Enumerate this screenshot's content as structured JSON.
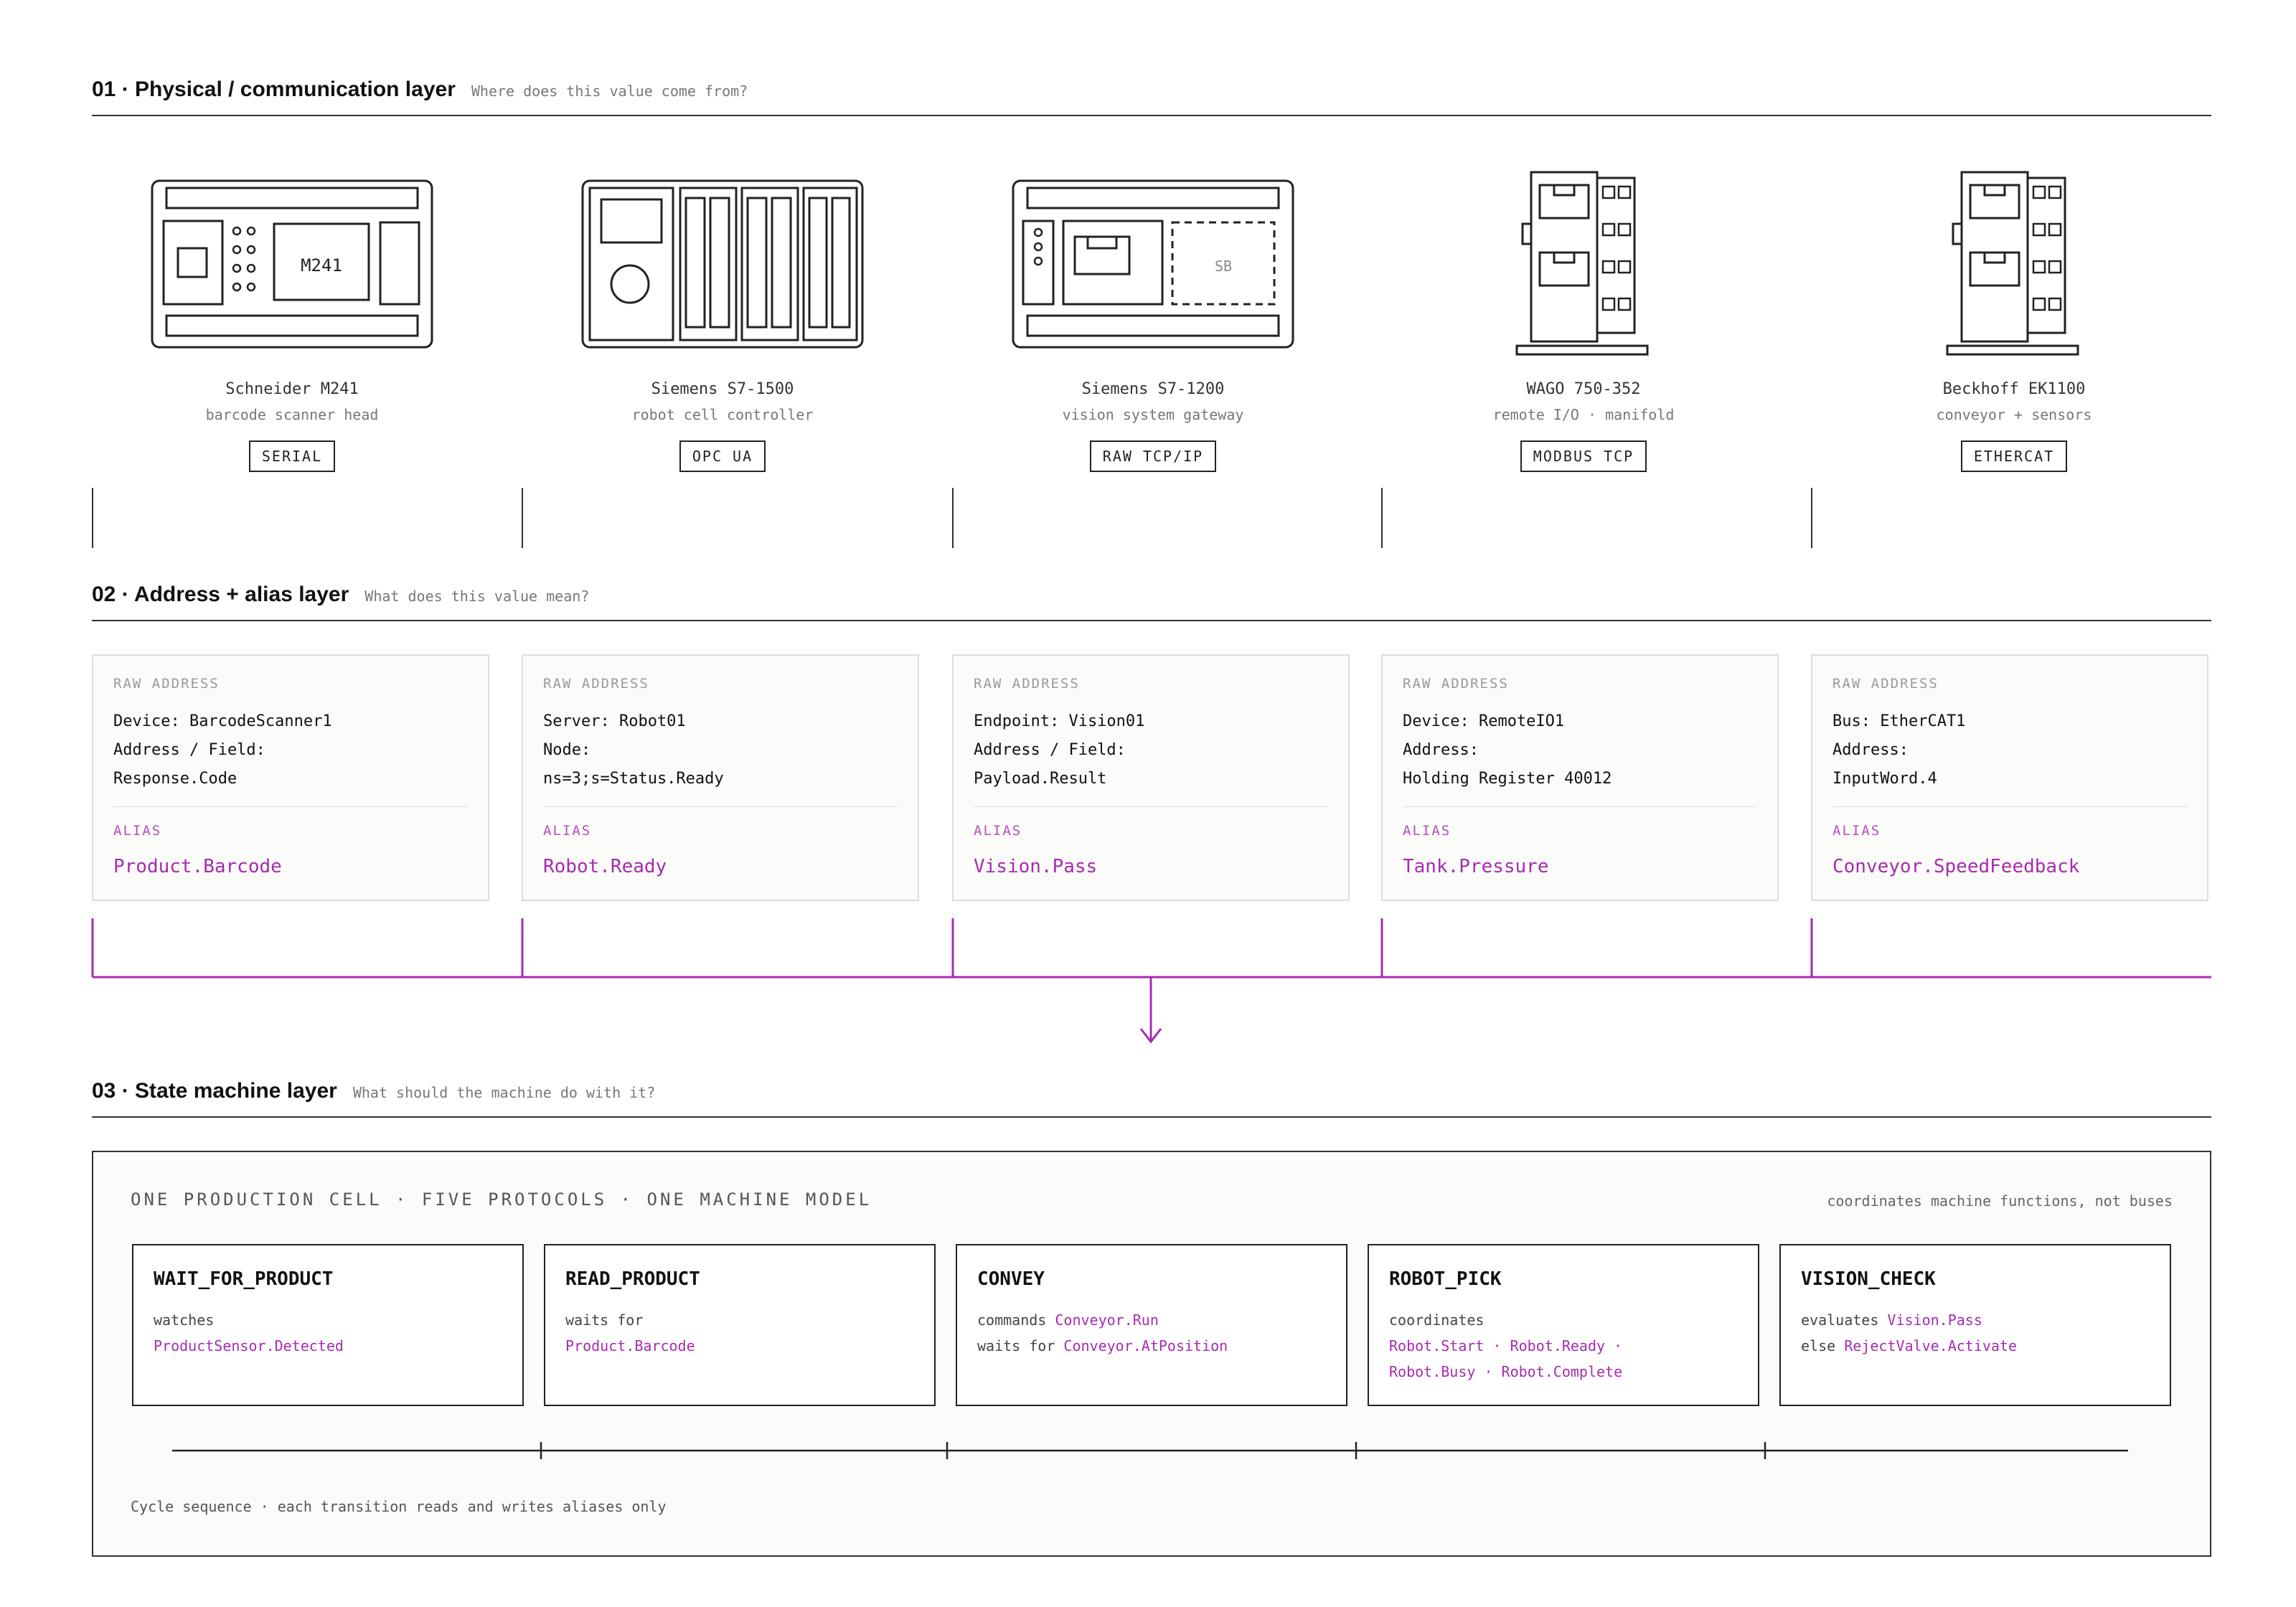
{
  "sections": {
    "s1": {
      "title": "01 · Physical / communication layer",
      "sub": "Where does this value come from?"
    },
    "s2": {
      "title": "02 · Address + alias layer",
      "sub": "What does this value mean?"
    },
    "s3": {
      "title": "03 · State machine layer",
      "sub": "What should the machine do with it?"
    }
  },
  "devices": [
    {
      "name": "Schneider M241",
      "desc": "barcode scanner head",
      "protocol": "SERIAL",
      "module_label": "M241",
      "icon": "plc-compact-icon"
    },
    {
      "name": "Siemens S7-1500",
      "desc": "robot cell controller",
      "protocol": "OPC UA",
      "icon": "plc-modular-icon"
    },
    {
      "name": "Siemens S7-1200",
      "desc": "vision system gateway",
      "protocol": "RAW TCP/IP",
      "module_label": "SB",
      "icon": "plc-signal-board-icon"
    },
    {
      "name": "WAGO 750-352",
      "desc": "remote I/O · manifold",
      "protocol": "MODBUS TCP",
      "icon": "remote-io-icon"
    },
    {
      "name": "Beckhoff EK1100",
      "desc": "conveyor + sensors",
      "protocol": "ETHERCAT",
      "icon": "bus-coupler-icon"
    }
  ],
  "cards": [
    {
      "raw_label": "RAW ADDRESS",
      "raw": "Device: BarcodeScanner1\nAddress / Field:\nResponse.Code",
      "alias_label": "ALIAS",
      "alias": "Product.Barcode"
    },
    {
      "raw_label": "RAW ADDRESS",
      "raw": "Server: Robot01\nNode:\nns=3;s=Status.Ready",
      "alias_label": "ALIAS",
      "alias": "Robot.Ready"
    },
    {
      "raw_label": "RAW ADDRESS",
      "raw": "Endpoint: Vision01\nAddress / Field:\nPayload.Result",
      "alias_label": "ALIAS",
      "alias": "Vision.Pass"
    },
    {
      "raw_label": "RAW ADDRESS",
      "raw": "Device: RemoteIO1\nAddress:\nHolding Register 40012",
      "alias_label": "ALIAS",
      "alias": "Tank.Pressure"
    },
    {
      "raw_label": "RAW ADDRESS",
      "raw": "Bus: EtherCAT1\nAddress:\nInputWord.4",
      "alias_label": "ALIAS",
      "alias": "Conveyor.SpeedFeedback"
    }
  ],
  "panel": {
    "heading": "ONE PRODUCTION CELL · FIVE PROTOCOLS · ONE MACHINE MODEL",
    "note": "coordinates machine functions, not buses",
    "cycle": "Cycle sequence · each transition reads and writes aliases only"
  },
  "states": [
    {
      "name": "WAIT_FOR_PRODUCT",
      "l1": "watches",
      "l1m": "",
      "l2": "",
      "l2m": "ProductSensor.Detected",
      "l3": ""
    },
    {
      "name": "READ_PRODUCT",
      "l1": "waits for",
      "l1m": "",
      "l2": "",
      "l2m": "Product.Barcode",
      "l3": ""
    },
    {
      "name": "CONVEY",
      "l1": "commands ",
      "l1m": "Conveyor.Run",
      "l2": "waits for ",
      "l2m": "Conveyor.AtPosition",
      "l3": ""
    },
    {
      "name": "ROBOT_PICK",
      "l1": "coordinates",
      "l1m": "",
      "l2": "",
      "l2m": "Robot.Start · Robot.Ready ·",
      "l3": "Robot.Busy · Robot.Complete"
    },
    {
      "name": "VISION_CHECK",
      "l1": "evaluates ",
      "l1m": "Vision.Pass",
      "l2": "else ",
      "l2m": "RejectValve.Activate",
      "l3": ""
    }
  ],
  "colors": {
    "accent": "#a62cb0",
    "ink": "#222222",
    "muted": "#777777"
  }
}
